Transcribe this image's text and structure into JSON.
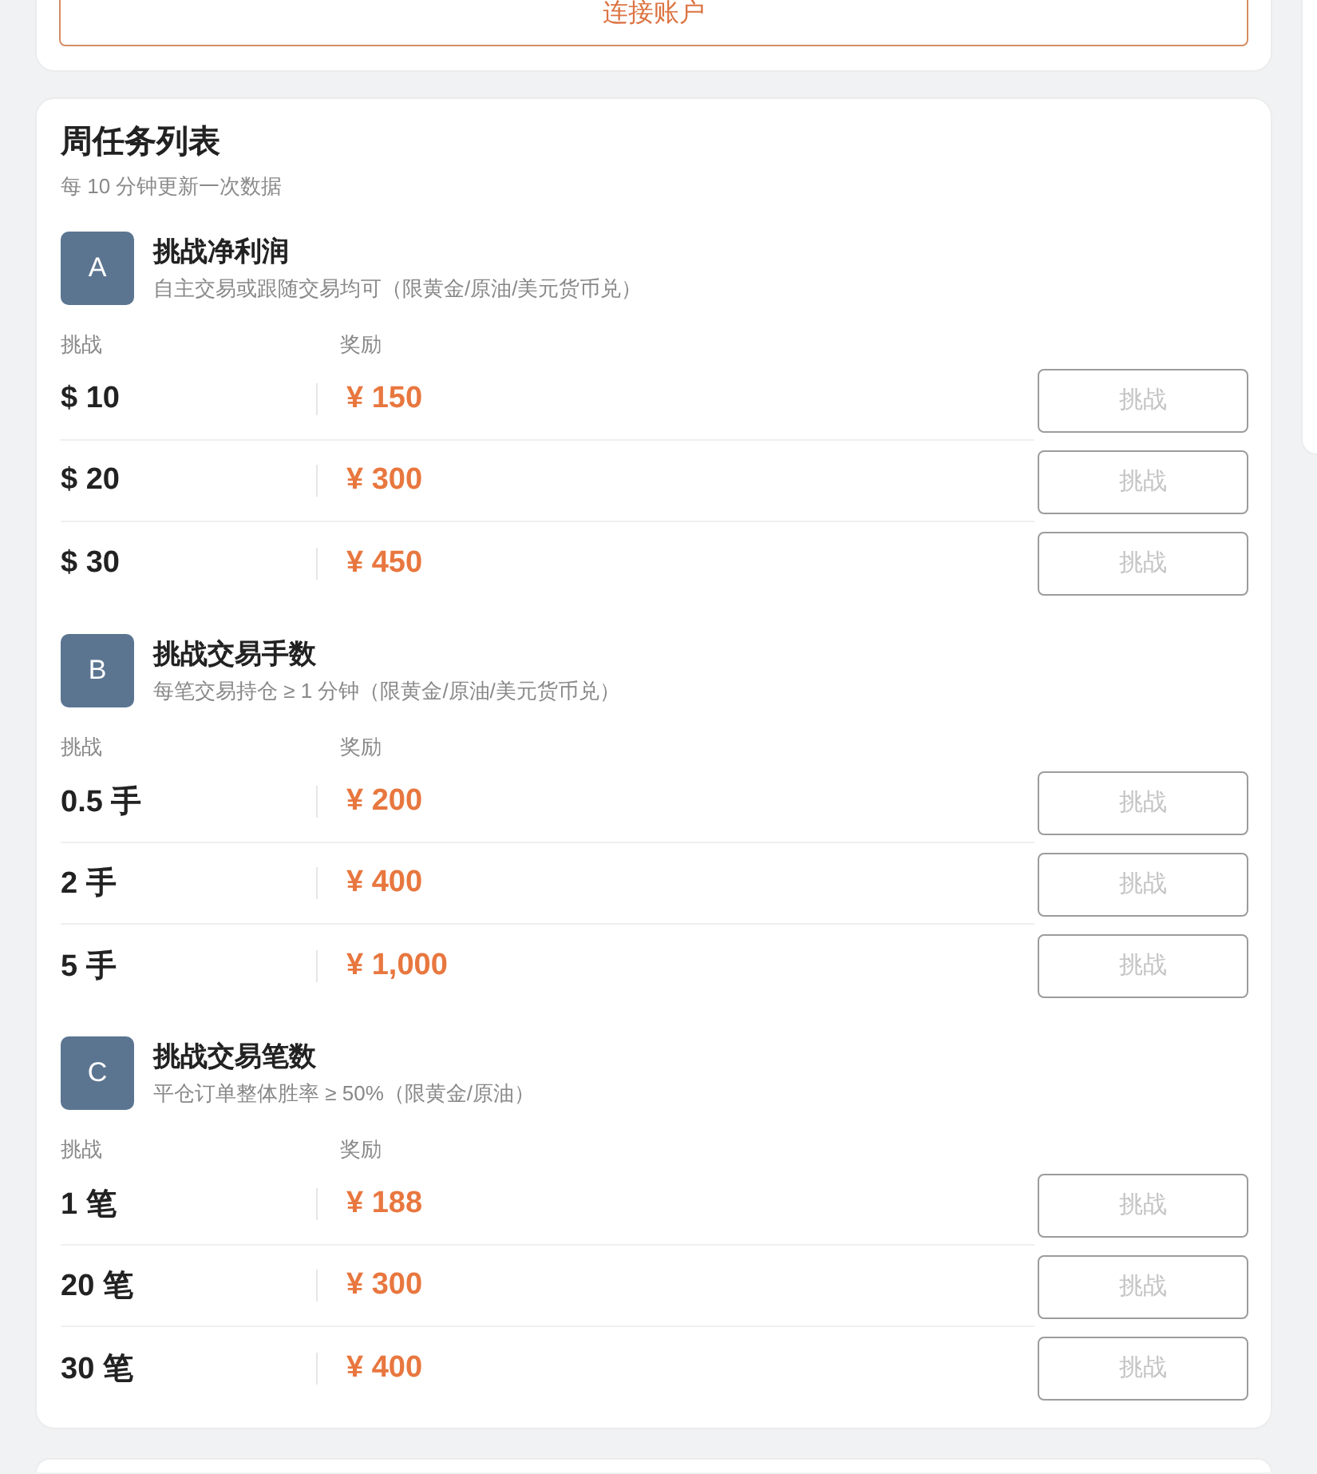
{
  "connect_button": {
    "label": "连接账户"
  },
  "weekly_tasks": {
    "title": "周任务列表",
    "subtitle": "每 10 分钟更新一次数据",
    "challenges": [
      {
        "badge": "A",
        "title": "挑战净利润",
        "description": "自主交易或跟随交易均可（限黄金/原油/美元货币兑）",
        "target_header": "挑战",
        "reward_header": "奖励",
        "tiers": [
          {
            "target": "$ 10",
            "reward": "¥ 150",
            "button_label": "挑战",
            "disabled": true
          },
          {
            "target": "$ 20",
            "reward": "¥ 300",
            "button_label": "挑战",
            "disabled": true
          },
          {
            "target": "$ 30",
            "reward": "¥ 450",
            "button_label": "挑战",
            "disabled": true
          }
        ]
      },
      {
        "badge": "B",
        "title": "挑战交易手数",
        "description": "每笔交易持仓 ≥ 1 分钟（限黄金/原油/美元货币兑）",
        "target_header": "挑战",
        "reward_header": "奖励",
        "tiers": [
          {
            "target": "0.5 手",
            "reward": "¥ 200",
            "button_label": "挑战",
            "disabled": true
          },
          {
            "target": "2 手",
            "reward": "¥ 400",
            "button_label": "挑战",
            "disabled": true
          },
          {
            "target": "5 手",
            "reward": "¥ 1,000",
            "button_label": "挑战",
            "disabled": true
          }
        ]
      },
      {
        "badge": "C",
        "title": "挑战交易笔数",
        "description": "平仓订单整体胜率 ≥ 50%（限黄金/原油）",
        "target_header": "挑战",
        "reward_header": "奖励",
        "tiers": [
          {
            "target": "1 笔",
            "reward": "¥ 188",
            "button_label": "挑战",
            "disabled": true
          },
          {
            "target": "20 笔",
            "reward": "¥ 300",
            "button_label": "挑战",
            "disabled": true
          },
          {
            "target": "30 笔",
            "reward": "¥ 400",
            "button_label": "挑战",
            "disabled": true
          }
        ]
      }
    ]
  }
}
